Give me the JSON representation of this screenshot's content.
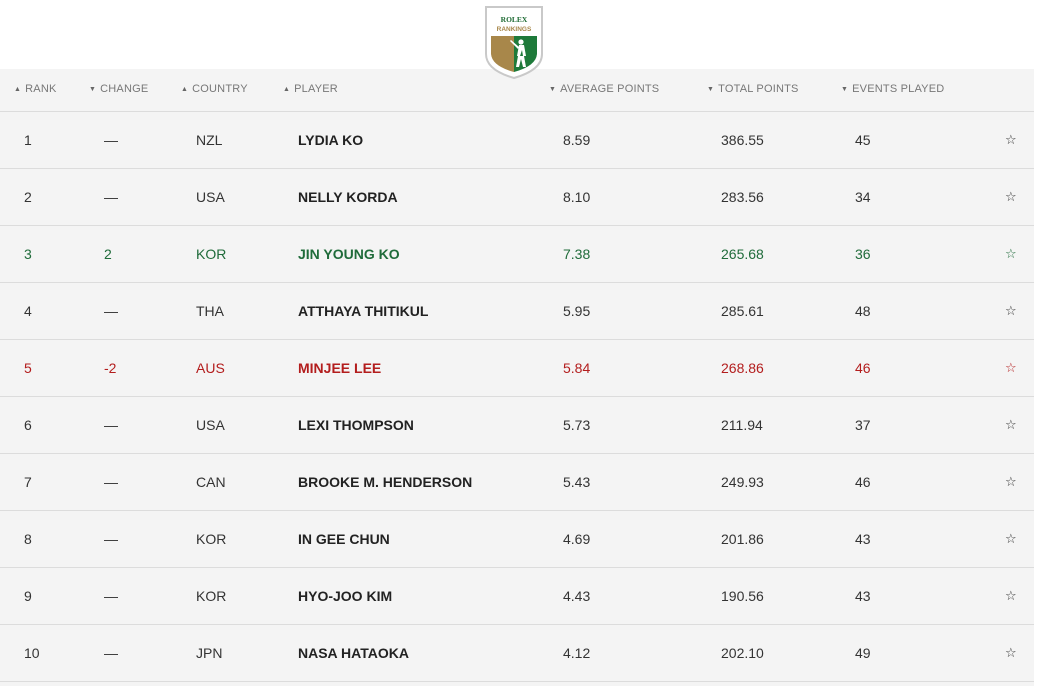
{
  "logo": {
    "top_text": "ROLEX",
    "bottom_text": "RANKINGS"
  },
  "columns": {
    "rank": "RANK",
    "change": "CHANGE",
    "country": "COUNTRY",
    "player": "PLAYER",
    "avg": "AVERAGE POINTS",
    "total": "TOTAL POINTS",
    "events": "EVENTS PLAYED"
  },
  "sort_icons": {
    "rank": "sort-ascending-icon",
    "change": "sort-descending-icon",
    "country": "sort-ascending-icon",
    "player": "sort-ascending-icon",
    "avg": "sort-descending-icon",
    "total": "sort-descending-icon",
    "events": "sort-descending-icon"
  },
  "colors": {
    "up": "#1f6b3a",
    "down": "#b31d1d",
    "neutral": "#333333"
  },
  "rows": [
    {
      "rank": "1",
      "change": "—",
      "country": "NZL",
      "player": "LYDIA KO",
      "avg": "8.59",
      "total": "386.55",
      "events": "45",
      "star": "☆",
      "trend": "neutral"
    },
    {
      "rank": "2",
      "change": "—",
      "country": "USA",
      "player": "NELLY KORDA",
      "avg": "8.10",
      "total": "283.56",
      "events": "34",
      "star": "☆",
      "trend": "neutral"
    },
    {
      "rank": "3",
      "change": "2",
      "country": "KOR",
      "player": "JIN YOUNG KO",
      "avg": "7.38",
      "total": "265.68",
      "events": "36",
      "star": "☆",
      "trend": "up"
    },
    {
      "rank": "4",
      "change": "—",
      "country": "THA",
      "player": "ATTHAYA THITIKUL",
      "avg": "5.95",
      "total": "285.61",
      "events": "48",
      "star": "☆",
      "trend": "neutral"
    },
    {
      "rank": "5",
      "change": "-2",
      "country": "AUS",
      "player": "MINJEE LEE",
      "avg": "5.84",
      "total": "268.86",
      "events": "46",
      "star": "☆",
      "trend": "down"
    },
    {
      "rank": "6",
      "change": "—",
      "country": "USA",
      "player": "LEXI THOMPSON",
      "avg": "5.73",
      "total": "211.94",
      "events": "37",
      "star": "☆",
      "trend": "neutral"
    },
    {
      "rank": "7",
      "change": "—",
      "country": "CAN",
      "player": "BROOKE M. HENDERSON",
      "avg": "5.43",
      "total": "249.93",
      "events": "46",
      "star": "☆",
      "trend": "neutral"
    },
    {
      "rank": "8",
      "change": "—",
      "country": "KOR",
      "player": "IN GEE CHUN",
      "avg": "4.69",
      "total": "201.86",
      "events": "43",
      "star": "☆",
      "trend": "neutral"
    },
    {
      "rank": "9",
      "change": "—",
      "country": "KOR",
      "player": "HYO-JOO KIM",
      "avg": "4.43",
      "total": "190.56",
      "events": "43",
      "star": "☆",
      "trend": "neutral"
    },
    {
      "rank": "10",
      "change": "—",
      "country": "JPN",
      "player": "NASA HATAOKA",
      "avg": "4.12",
      "total": "202.10",
      "events": "49",
      "star": "☆",
      "trend": "neutral"
    }
  ]
}
